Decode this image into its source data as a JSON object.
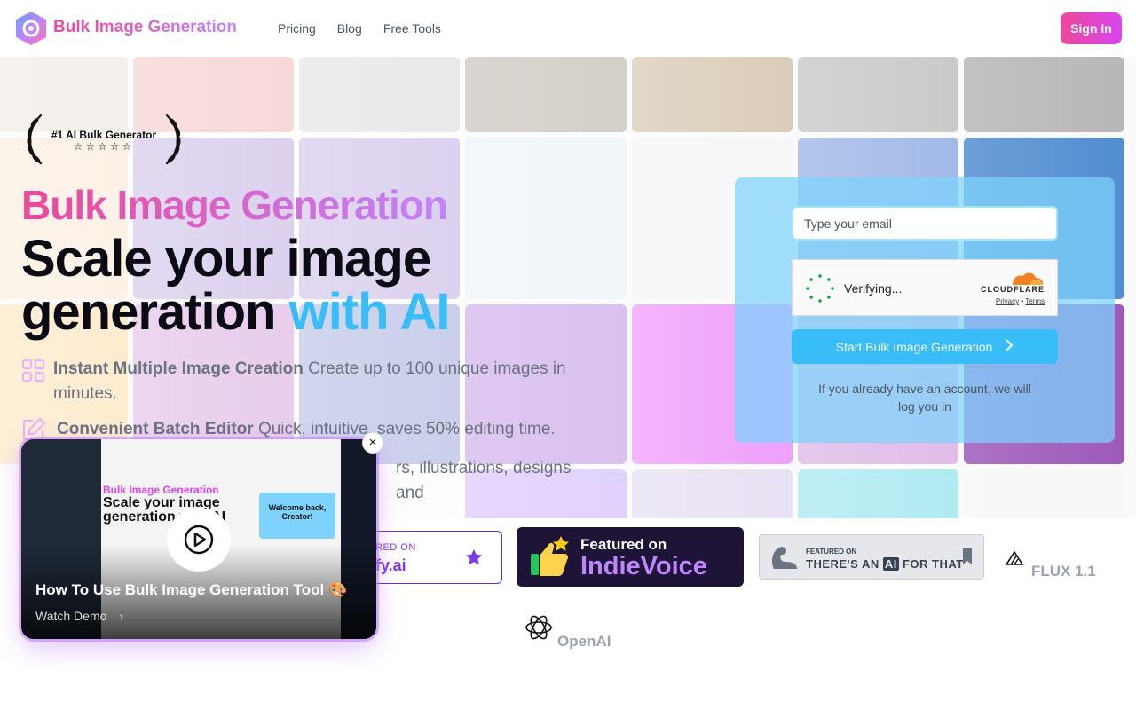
{
  "header": {
    "brand": "Bulk Image Generation",
    "nav": [
      "Pricing",
      "Blog",
      "Free Tools"
    ],
    "signin": "Sign In"
  },
  "hero": {
    "award_title": "#1 AI Bulk Generator",
    "award_stars": "☆☆☆☆☆",
    "gradient_title": "Bulk Image Generation",
    "line1": "Scale your image",
    "line2_prefix": "generation ",
    "line2_accent": "with AI",
    "features": [
      {
        "title": "Instant Multiple Image Creation",
        "text": " Create up to 100 unique images in minutes."
      },
      {
        "title": "Convenient Batch Editor",
        "text": " Quick, intuitive, saves 50% editing time."
      },
      {
        "title": "",
        "text": "rs, illustrations, designs and"
      }
    ]
  },
  "signup": {
    "email_placeholder": "Type your email",
    "captcha_status": "Verifying...",
    "captcha_brand": "CLOUDFLARE",
    "captcha_privacy": "Privacy",
    "captcha_sep": "•",
    "captcha_terms": "Terms",
    "start_button": "Start Bulk Image Generation",
    "note": "If you already have an account, we will log you in"
  },
  "badges": {
    "product_top": "RED ON",
    "product_main": "fy.ai",
    "indie_top": "Featured on",
    "indie_main": "IndieVoice",
    "taaft_top": "FEATURED ON",
    "taaft_main_a": "THERE'S AN ",
    "taaft_main_ai": "AI",
    "taaft_main_b": " FOR THAT",
    "flux": "FLUX 1.1",
    "openai": "OpenAI"
  },
  "video": {
    "title": "How To Use Bulk Image Generation Tool 🎨",
    "watch": "Watch Demo",
    "mini_title": "Bulk Image Generation",
    "mini_h1": "Scale your image generation with AI",
    "mini_card": "Welcome back, Creator!",
    "close": "×"
  },
  "colors": {
    "brand_pink": "#ec4899",
    "brand_purple": "#c084fc",
    "accent_sky": "#38bdf8",
    "panel": "#7dd3fc"
  }
}
